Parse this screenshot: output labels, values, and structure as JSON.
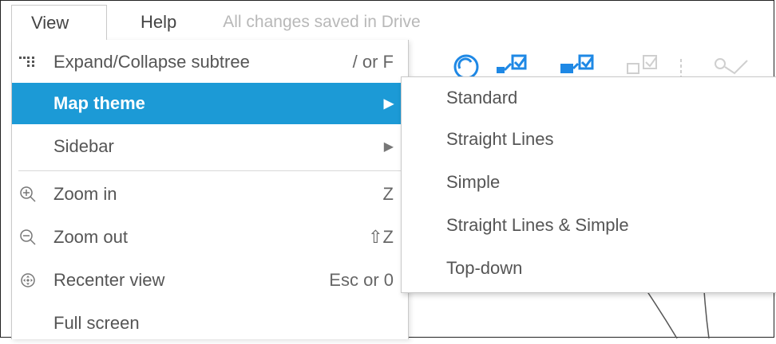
{
  "menubar": {
    "view_label": "View",
    "help_label": "Help",
    "save_status": "All changes saved in Drive"
  },
  "view_menu": {
    "items": [
      {
        "label": "Expand/Collapse subtree",
        "shortcut": "/ or F",
        "icon": "expand-collapse-icon"
      },
      {
        "label": "Map theme",
        "icon": "submenu-arrow-icon",
        "active": true
      },
      {
        "label": "Sidebar",
        "icon": "submenu-arrow-icon"
      },
      {
        "label": "Zoom in",
        "shortcut": "Z",
        "icon": "zoom-in-icon"
      },
      {
        "label": "Zoom out",
        "shortcut": "⇧Z",
        "icon": "zoom-out-icon"
      },
      {
        "label": "Recenter view",
        "shortcut": "Esc or 0",
        "icon": "recenter-icon"
      },
      {
        "label": "Full screen"
      }
    ]
  },
  "map_theme_submenu": {
    "items": [
      "Standard",
      "Straight Lines",
      "Simple",
      "Straight Lines & Simple",
      "Top-down"
    ]
  },
  "colors": {
    "accent": "#1c9ad6",
    "toolbar_icon": "#1e88e5",
    "toolbar_icon_disabled": "#cfcfcf"
  }
}
